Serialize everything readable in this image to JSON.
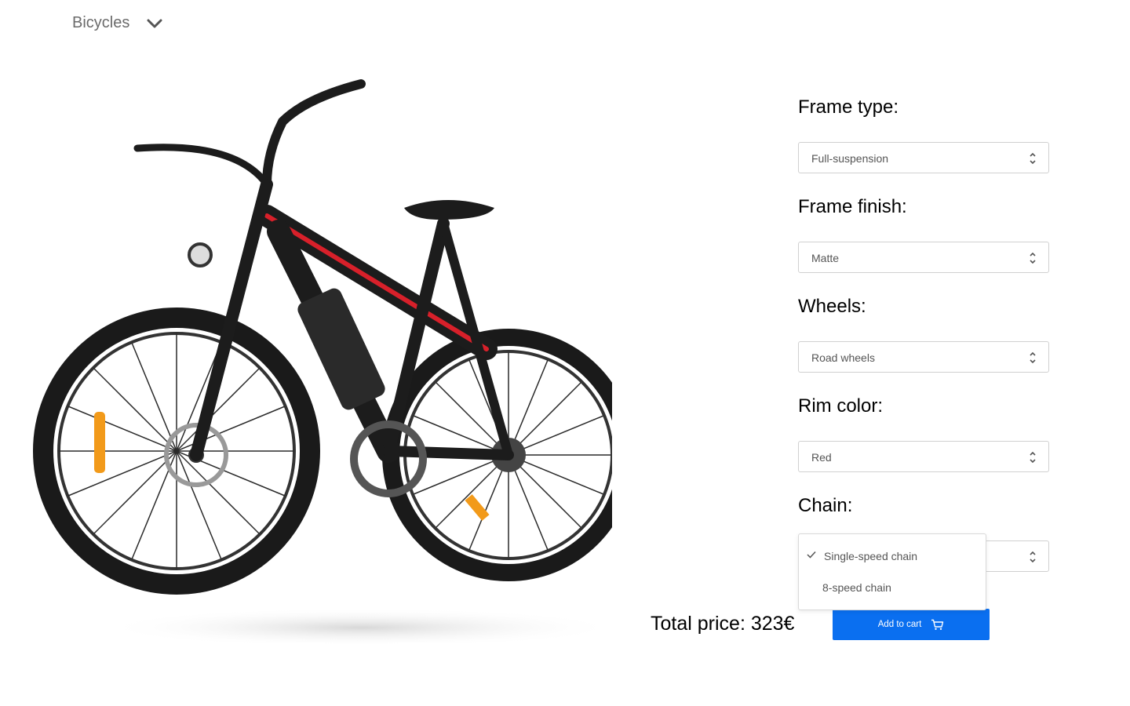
{
  "category": {
    "label": "Bicycles",
    "icon": "chevron-down-icon"
  },
  "product_image": {
    "alt": "electric-mountain-bike"
  },
  "options": [
    {
      "label": "Frame type:",
      "value": "Full-suspension"
    },
    {
      "label": "Frame finish:",
      "value": "Matte"
    },
    {
      "label": "Wheels:",
      "value": "Road wheels"
    },
    {
      "label": "Rim color:",
      "value": "Red"
    },
    {
      "label": "Chain:",
      "value": "Single-speed chain"
    }
  ],
  "chain_dropdown": {
    "open": true,
    "items": [
      {
        "label": "Single-speed chain",
        "selected": true
      },
      {
        "label": "8-speed chain",
        "selected": false
      }
    ]
  },
  "total": {
    "prefix": "Total price: ",
    "amount": "323€"
  },
  "cart_button": {
    "label": "Add to cart",
    "icon": "shopping-cart-icon"
  },
  "colors": {
    "accent": "#0a6ff0",
    "frame_red": "#d8202a"
  }
}
